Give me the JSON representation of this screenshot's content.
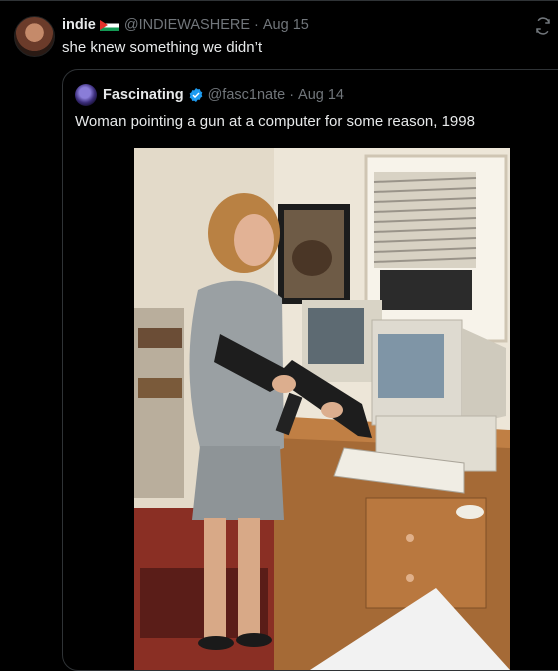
{
  "tweet": {
    "display_name": "indie",
    "flag_icon": "palestine-flag-icon",
    "handle": "@INDIEWASHERE",
    "separator": "·",
    "date": "Aug 15",
    "text": "she knew something we didn’t"
  },
  "quoted": {
    "display_name": "Fascinating",
    "verified_icon": "verified-badge-icon",
    "handle": "@fasc1nate",
    "separator": "·",
    "date": "Aug 14",
    "text": "Woman pointing a gun at a computer for some reason, 1998",
    "image_icon": "photo-woman-gun-computer"
  },
  "colors": {
    "background": "#000000",
    "text": "#e7e9ea",
    "muted": "#71767b",
    "border": "#2f3336",
    "verified": "#1d9bf0"
  }
}
